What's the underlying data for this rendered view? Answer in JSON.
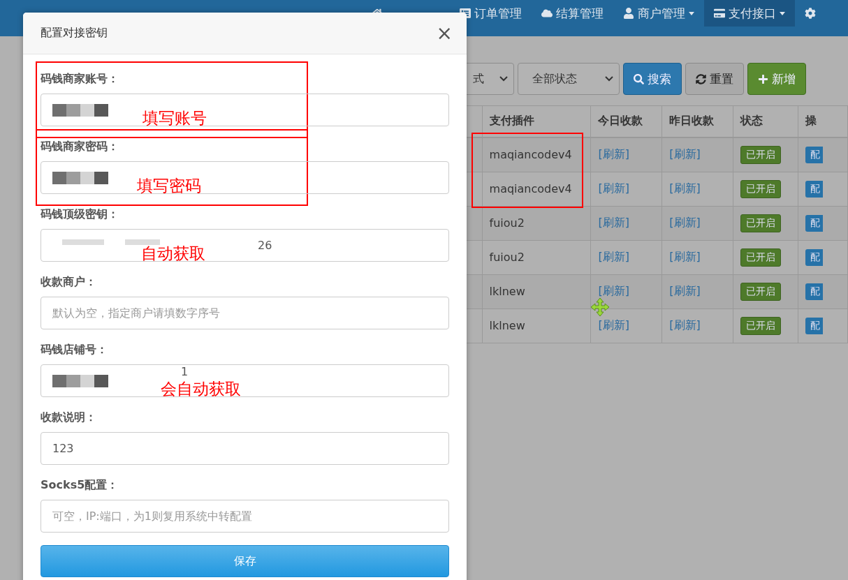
{
  "navbar": {
    "items": [
      {
        "kind": "home",
        "selected": false,
        "dropdown": false
      },
      {
        "kind": "list",
        "label": "订单管理",
        "selected": false,
        "dropdown": false
      },
      {
        "kind": "cloud",
        "label": "结算管理",
        "selected": false,
        "dropdown": false
      },
      {
        "kind": "user",
        "label": "商户管理",
        "selected": false,
        "dropdown": true
      },
      {
        "kind": "card",
        "label": "支付接口",
        "selected": true,
        "dropdown": true
      },
      {
        "kind": "gear",
        "selected": false,
        "dropdown": false
      }
    ]
  },
  "toolbar": {
    "selects": [
      "式",
      "全部状态"
    ],
    "buttons": [
      {
        "kind": "search",
        "label": "搜索"
      },
      {
        "kind": "reset",
        "label": "重置"
      },
      {
        "kind": "add",
        "label": "新增"
      }
    ]
  },
  "table": {
    "columns": [
      "支付插件",
      "今日收款",
      "昨日收款",
      "状态",
      "操"
    ],
    "rows": [
      {
        "plugin": "maqiancodev4",
        "today": "[刷新]",
        "yesterday": "[刷新]",
        "status": "已开启",
        "action": "配",
        "highlighted": true
      },
      {
        "plugin": "maqiancodev4",
        "today": "[刷新]",
        "yesterday": "[刷新]",
        "status": "已开启",
        "action": "配",
        "highlighted": true
      },
      {
        "plugin": "fuiou2",
        "today": "[刷新]",
        "yesterday": "[刷新]",
        "status": "已开启",
        "action": "配",
        "highlighted": false
      },
      {
        "plugin": "fuiou2",
        "today": "[刷新]",
        "yesterday": "[刷新]",
        "status": "已开启",
        "action": "配",
        "highlighted": false
      },
      {
        "plugin": "lklnew",
        "today": "[刷新]",
        "yesterday": "[刷新]",
        "status": "已开启",
        "action": "配",
        "highlighted": false
      },
      {
        "plugin": "lklnew",
        "today": "[刷新]",
        "yesterday": "[刷新]",
        "status": "已开启",
        "action": "配",
        "highlighted": false
      }
    ]
  },
  "modal": {
    "title": "配置对接密钥",
    "close": "×",
    "fields": [
      {
        "label": "码钱商家账号：",
        "kind": "redacted",
        "annotation": "填写账号",
        "highlighted": true
      },
      {
        "label": "码钱商家密码：",
        "kind": "redacted",
        "annotation": "填写密码",
        "highlighted": true
      },
      {
        "label": "码钱顶级密钥：",
        "kind": "blurred",
        "value": "26",
        "annotation": "自动获取",
        "highlighted": false
      },
      {
        "label": "收款商户：",
        "kind": "text",
        "placeholder": "默认为空，指定商户请填数字序号",
        "highlighted": false
      },
      {
        "label": "码钱店铺号：",
        "kind": "redacted",
        "value": "1",
        "annotation": "会自动获取",
        "highlighted": false
      },
      {
        "label": "收款说明：",
        "kind": "text",
        "value": "123",
        "highlighted": false
      },
      {
        "label": "Socks5配置：",
        "kind": "text",
        "placeholder": "可空，IP:端口，为1则复用系统中转配置",
        "highlighted": false
      }
    ],
    "submit": "保存"
  }
}
